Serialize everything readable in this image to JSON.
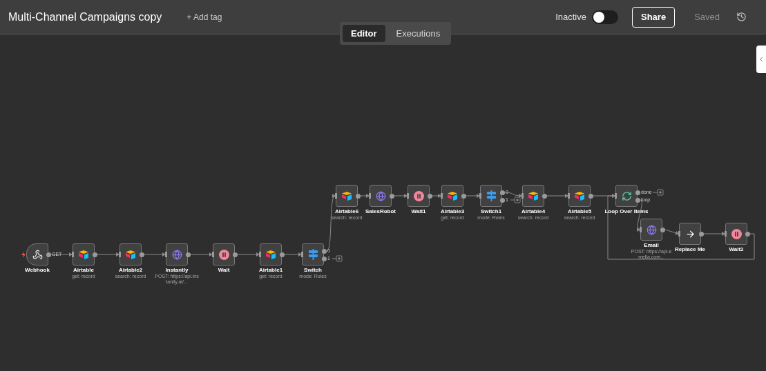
{
  "title": "Multi-Channel Campaigns copy",
  "add_tag": "+ Add tag",
  "active_label": "Inactive",
  "active": false,
  "share": "Share",
  "saved": "Saved",
  "tabs": [
    {
      "label": "Editor",
      "selected": true
    },
    {
      "label": "Executions",
      "selected": false
    }
  ],
  "nodes": [
    {
      "name": "Webhook",
      "kind": "webhook",
      "outputs": [
        "GET"
      ]
    },
    {
      "name": "Airtable",
      "subtitle": "get: record",
      "kind": "airtable"
    },
    {
      "name": "Airtable2",
      "subtitle": "search: record",
      "kind": "airtable"
    },
    {
      "name": "Instantly",
      "subtitle": "POST: https://api.instantly.ai/...",
      "kind": "http"
    },
    {
      "name": "Wait",
      "kind": "wait"
    },
    {
      "name": "Airtable1",
      "subtitle": "get: record",
      "kind": "airtable"
    },
    {
      "name": "Switch",
      "subtitle": "mode: Rules",
      "kind": "switch",
      "outputs": [
        "0",
        "1"
      ]
    },
    {
      "name": "Airtable6",
      "subtitle": "search: record",
      "kind": "airtable"
    },
    {
      "name": "SalesRobot",
      "kind": "http"
    },
    {
      "name": "Wait1",
      "kind": "wait"
    },
    {
      "name": "Airtable3",
      "subtitle": "get: record",
      "kind": "airtable"
    },
    {
      "name": "Switch1",
      "subtitle": "mode: Rules",
      "kind": "switch",
      "outputs": [
        "0",
        "1"
      ]
    },
    {
      "name": "Airtable4",
      "subtitle": "search: record",
      "kind": "airtable"
    },
    {
      "name": "Airtable5",
      "subtitle": "search: record",
      "kind": "airtable"
    },
    {
      "name": "Loop Over Items",
      "kind": "loop",
      "outputs": [
        "done",
        "loop"
      ]
    },
    {
      "name": "Email",
      "subtitle": "POST: https://api.emelia.com...",
      "kind": "http"
    },
    {
      "name": "Replace Me",
      "kind": "noop"
    },
    {
      "name": "Wait2",
      "kind": "wait"
    }
  ]
}
